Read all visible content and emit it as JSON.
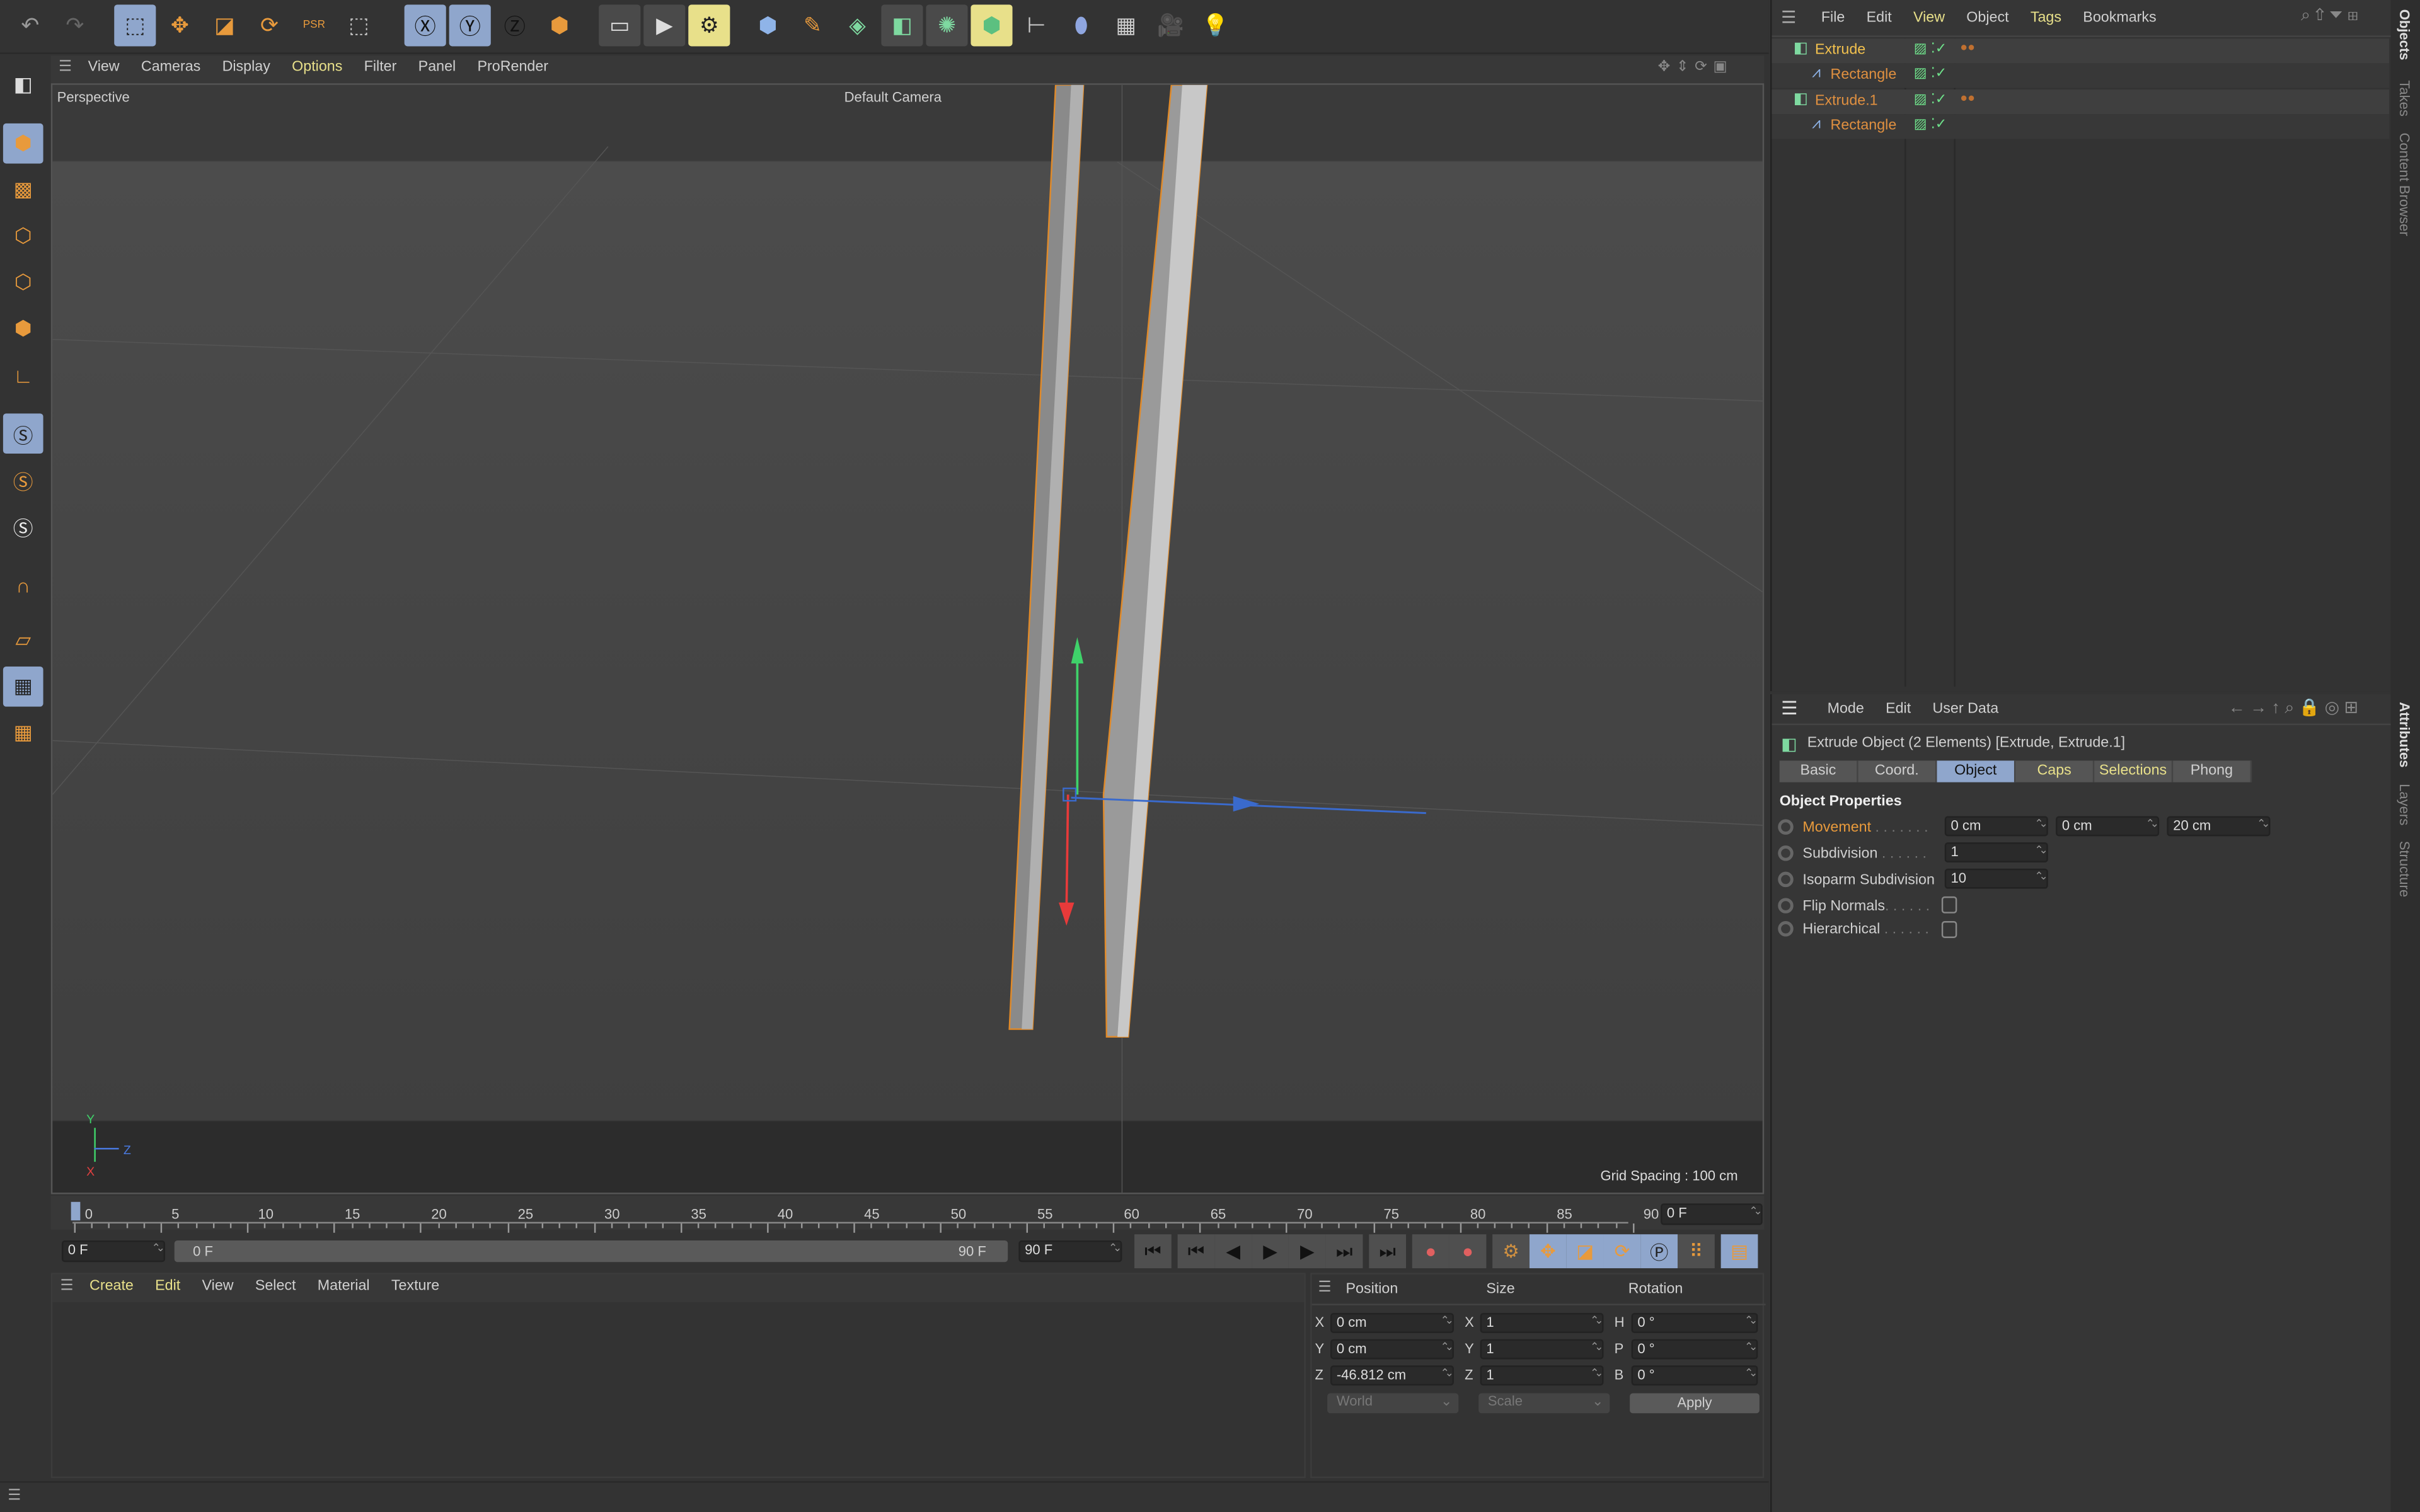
{
  "top_toolbar": {
    "icons": [
      "undo-icon",
      "redo-icon",
      "live-selection-icon",
      "move-icon",
      "scale-icon",
      "rotate-icon",
      "psr-icon",
      "recent-tools-icon",
      "x-axis-lock-icon",
      "y-axis-lock-icon",
      "z-axis-lock-icon",
      "coordinate-system-icon",
      "render-view-icon",
      "render-picture-viewer-icon",
      "render-settings-icon",
      "cube-icon",
      "pen-icon",
      "subdivision-icon",
      "extrude-generator-icon",
      "cloner-icon",
      "mograph-icon",
      "deformer-icon",
      "field-icon",
      "floor-icon",
      "camera-icon",
      "light-icon"
    ]
  },
  "viewport": {
    "menu": [
      "View",
      "Cameras",
      "Display",
      "Options",
      "Filter",
      "Panel",
      "ProRender"
    ],
    "active_menu": "Options",
    "view_name": "Perspective",
    "camera": "Default Camera",
    "grid_spacing": "Grid Spacing : 100 cm",
    "axis_labels": {
      "x": "X",
      "y": "Y",
      "z": "Z"
    }
  },
  "timeline": {
    "ticks": [
      "0",
      "5",
      "10",
      "15",
      "20",
      "25",
      "30",
      "35",
      "40",
      "45",
      "50",
      "55",
      "60",
      "65",
      "70",
      "75",
      "80",
      "85",
      "90"
    ],
    "current_frame": "0 F",
    "start_field": "0 F",
    "range_start": "0 F",
    "range_end": "90 F",
    "end_field": "90 F"
  },
  "material_manager": {
    "menu": [
      "Create",
      "Edit",
      "View",
      "Select",
      "Material",
      "Texture"
    ]
  },
  "coordinates": {
    "headers": [
      "Position",
      "Size",
      "Rotation"
    ],
    "rows": [
      {
        "pl": "X",
        "pv": "0 cm",
        "sl": "X",
        "sv": "1",
        "rl": "H",
        "rv": "0 °"
      },
      {
        "pl": "Y",
        "pv": "0 cm",
        "sl": "Y",
        "sv": "1",
        "rl": "P",
        "rv": "0 °"
      },
      {
        "pl": "Z",
        "pv": "-46.812 cm",
        "sl": "Z",
        "sv": "1",
        "rl": "B",
        "rv": "0 °"
      }
    ],
    "coord_system": "World",
    "size_mode": "Scale",
    "apply": "Apply"
  },
  "object_manager": {
    "menu": [
      "File",
      "Edit",
      "View",
      "Object",
      "Tags",
      "Bookmarks"
    ],
    "objects": [
      {
        "name": "Extrude",
        "level": 0
      },
      {
        "name": "Rectangle",
        "level": 1
      },
      {
        "name": "Extrude.1",
        "level": 0
      },
      {
        "name": "Rectangle",
        "level": 1
      }
    ]
  },
  "attributes": {
    "menu": [
      "Mode",
      "Edit",
      "User Data"
    ],
    "title": "Extrude Object (2 Elements) [Extrude, Extrude.1]",
    "tabs": [
      "Basic",
      "Coord.",
      "Object",
      "Caps",
      "Selections",
      "Phong"
    ],
    "active_tab": "Object",
    "section": "Object Properties",
    "props": {
      "movement": {
        "label": "Movement",
        "values": [
          "0 cm",
          "0 cm",
          "20 cm"
        ]
      },
      "subdivision": {
        "label": "Subdivision",
        "value": "1"
      },
      "isoparm": {
        "label": "Isoparm Subdivision",
        "value": "10"
      },
      "flip": {
        "label": "Flip Normals",
        "checked": false
      },
      "hier": {
        "label": "Hierarchical",
        "checked": false
      }
    }
  },
  "side_tabs": {
    "top": [
      "Objects",
      "Takes",
      "Content Browser"
    ],
    "bottom": [
      "Attributes",
      "Layers",
      "Structure"
    ]
  },
  "colors": {
    "accent": "#8fa6cc",
    "orange": "#e89a3c",
    "highlight_text": "#e8e08a"
  }
}
